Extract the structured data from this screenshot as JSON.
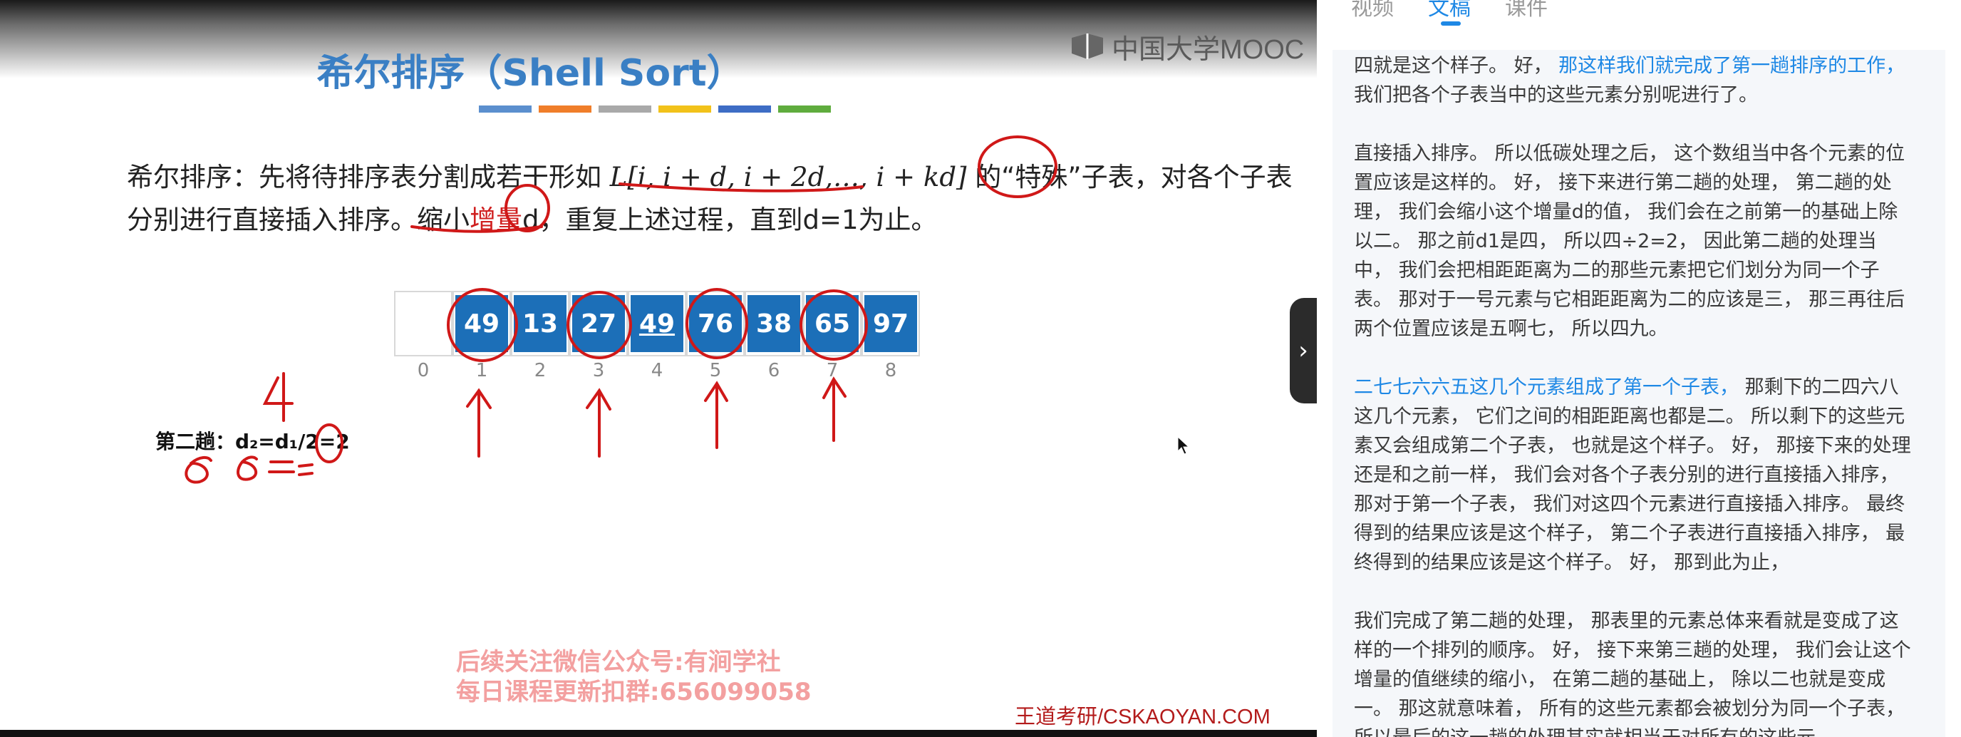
{
  "slide": {
    "logo_text": "中国大学MOOC",
    "title": "希尔排序（Shell Sort）",
    "color_strip": [
      "#5b8fce",
      "#f07e2a",
      "#a9a9a9",
      "#f2c21a",
      "#3e6dc5",
      "#5fac3e"
    ],
    "line1_a": "希尔排序：先将待排序表分割成若干形如 ",
    "line1_formula": "L[i, i + d, i + 2d,…, i + kd]",
    "line1_b": " 的“特殊”子表，对各个子表",
    "line2_a": "分别进行直接插入排序。缩小",
    "line2_red": "增量",
    "line2_b": "d，重复上述过程，直到d=1为止。",
    "array": [
      {
        "value": ""
      },
      {
        "value": "49"
      },
      {
        "value": "13"
      },
      {
        "value": "27"
      },
      {
        "value": "49",
        "underlined": true
      },
      {
        "value": "76"
      },
      {
        "value": "38"
      },
      {
        "value": "65"
      },
      {
        "value": "97"
      }
    ],
    "indices": [
      "0",
      "1",
      "2",
      "3",
      "4",
      "5",
      "6",
      "7",
      "8"
    ],
    "pass2_label": "第二趟：d₂=d₁/2=2",
    "handwritten_four": "4",
    "watermark_line1": "后续关注微信公众号:有涧学社",
    "watermark_line2": "每日课程更新扣群:656099058",
    "brand": "王道考研/CSKAOYAN.COM"
  },
  "panel": {
    "tabs": [
      {
        "label": "视频",
        "active": false
      },
      {
        "label": "文稿",
        "active": true
      },
      {
        "label": "课件",
        "active": false
      }
    ],
    "p1_a": "四就是这个样子。 好， ",
    "p1_hl": "那这样我们就完成了第一趟排序的工作，",
    "p1_b": " 我们把各个子表当中的这些元素分别呢进行了。",
    "p2": "直接插入排序。 所以低碳处理之后， 这个数组当中各个元素的位置应该是这样的。 好， 接下来进行第二趟的处理， 第二趟的处理， 我们会缩小这个增量d的值， 我们会在之前第一的基础上除以二。 那之前d1是四， 所以四÷2=2， 因此第二趟的处理当中， 我们会把相距距离为二的那些元素把它们划分为同一个子表。 那对于一号元素与它相距距离为二的应该是三， 那三再往后两个位置应该是五啊七， 所以四九。",
    "p3_hl": "二七七六六五这几个元素组成了第一个子表，",
    "p3_b": " 那剩下的二四六八这几个元素， 它们之间的相距距离也都是二。 所以剩下的这些元素又会组成第二个子表， 也就是这个样子。 好， 那接下来的处理还是和之前一样， 我们会对各个子表分别的进行直接插入排序， 那对于第一个子表， 我们对这四个元素进行直接插入排序。 最终得到的结果应该是这个样子， 第二个子表进行直接插入排序， 最终得到的结果应该是这个样子。 好， 那到此为止，",
    "p4": "我们完成了第二趟的处理， 那表里的元素总体来看就是变成了这样的一个排列的顺序。 好， 接下来第三趟的处理， 我们会让这个增量的值继续的缩小， 在第二趟的基础上， 除以二也就是变成一。 那这就意味着， 所有的这些元素都会被划分为同一个子表， 所以最后的这一趟的处理其实就相当于对所有的这些元"
  }
}
